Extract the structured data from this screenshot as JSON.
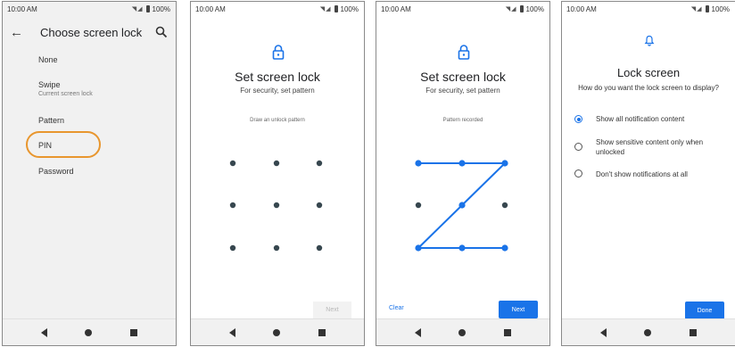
{
  "status": {
    "time": "10:00 AM",
    "battery": "100%"
  },
  "screen1": {
    "title": "Choose screen lock",
    "options": [
      {
        "label": "None",
        "sub": ""
      },
      {
        "label": "Swipe",
        "sub": "Current screen lock"
      },
      {
        "label": "Pattern",
        "sub": ""
      },
      {
        "label": "PIN",
        "sub": "",
        "highlighted": true
      },
      {
        "label": "Password",
        "sub": ""
      }
    ],
    "highlight_color": "#e8962e"
  },
  "screen2": {
    "title": "Set screen lock",
    "subtitle": "For security, set pattern",
    "hint": "Draw an unlock pattern",
    "next_label": "Next"
  },
  "screen3": {
    "title": "Set screen lock",
    "subtitle": "For security, set pattern",
    "hint": "Pattern recorded",
    "clear_label": "Clear",
    "next_label": "Next",
    "pattern_path": [
      1,
      2,
      3,
      5,
      7,
      8,
      9
    ]
  },
  "screen4": {
    "title": "Lock screen",
    "question": "How do you want the lock screen to display?",
    "options": [
      {
        "label": "Show all notification content",
        "selected": true
      },
      {
        "label": "Show sensitive content only when unlocked",
        "selected": false
      },
      {
        "label": "Don't show notifications at all",
        "selected": false
      }
    ],
    "done_label": "Done"
  },
  "colors": {
    "accent": "#1a73e8",
    "pattern_dot": "#37474f"
  }
}
